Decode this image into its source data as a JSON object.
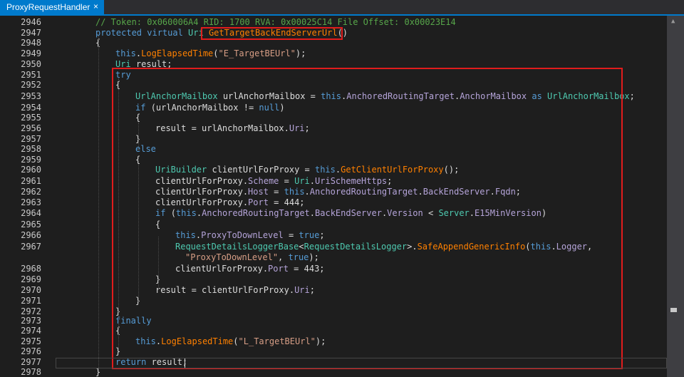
{
  "tab": {
    "title": "ProxyRequestHandler",
    "close_glyph": "×"
  },
  "colors": {
    "background": "#1e1e1e",
    "tab_active": "#007acc",
    "highlight_box": "#e01c1c",
    "comment": "#57a64a",
    "keyword": "#569cd6",
    "type": "#4ec9b0",
    "method": "#ff8000",
    "string": "#d69d85"
  },
  "lines": [
    {
      "n": "2946",
      "tokens": [
        [
          "c",
          "// Token: 0x060006A4 RID: 1700 RVA: 0x00025C14 File Offset: 0x00023E14"
        ]
      ]
    },
    {
      "n": "2947",
      "tokens": [
        [
          "k",
          "protected virtual "
        ],
        [
          "t",
          "Uri "
        ],
        [
          "m",
          "GetTargetBackEndServerUrl"
        ],
        [
          "p",
          "()"
        ]
      ]
    },
    {
      "n": "2948",
      "tokens": [
        [
          "p",
          "{"
        ]
      ]
    },
    {
      "n": "2949",
      "tokens": [
        [
          "k",
          "this"
        ],
        [
          "p",
          "."
        ],
        [
          "m",
          "LogElapsedTime"
        ],
        [
          "p",
          "("
        ],
        [
          "s",
          "\"E_TargetBEUrl\""
        ],
        [
          "p",
          ");"
        ]
      ]
    },
    {
      "n": "2950",
      "tokens": [
        [
          "t",
          "Uri "
        ],
        [
          "p",
          "result;"
        ]
      ]
    },
    {
      "n": "2951",
      "tokens": [
        [
          "k",
          "try"
        ]
      ]
    },
    {
      "n": "2952",
      "tokens": [
        [
          "p",
          "{"
        ]
      ]
    },
    {
      "n": "2953",
      "tokens": [
        [
          "t",
          "UrlAnchorMailbox "
        ],
        [
          "p",
          "urlAnchorMailbox = "
        ],
        [
          "k",
          "this"
        ],
        [
          "p",
          "."
        ],
        [
          "r",
          "AnchoredRoutingTarget"
        ],
        [
          "p",
          "."
        ],
        [
          "r",
          "AnchorMailbox "
        ],
        [
          "k",
          "as "
        ],
        [
          "t",
          "UrlAnchorMailbox"
        ],
        [
          "p",
          ";"
        ]
      ]
    },
    {
      "n": "2954",
      "tokens": [
        [
          "k",
          "if "
        ],
        [
          "p",
          "(urlAnchorMailbox != "
        ],
        [
          "k",
          "null"
        ],
        [
          "p",
          ")"
        ]
      ]
    },
    {
      "n": "2955",
      "tokens": [
        [
          "p",
          "{"
        ]
      ]
    },
    {
      "n": "2956",
      "tokens": [
        [
          "p",
          "result = urlAnchorMailbox."
        ],
        [
          "r",
          "Uri"
        ],
        [
          "p",
          ";"
        ]
      ]
    },
    {
      "n": "2957",
      "tokens": [
        [
          "p",
          "}"
        ]
      ]
    },
    {
      "n": "2958",
      "tokens": [
        [
          "k",
          "else"
        ]
      ]
    },
    {
      "n": "2959",
      "tokens": [
        [
          "p",
          "{"
        ]
      ]
    },
    {
      "n": "2960",
      "tokens": [
        [
          "t",
          "UriBuilder "
        ],
        [
          "p",
          "clientUrlForProxy = "
        ],
        [
          "k",
          "this"
        ],
        [
          "p",
          "."
        ],
        [
          "m",
          "GetClientUrlForProxy"
        ],
        [
          "p",
          "();"
        ]
      ]
    },
    {
      "n": "2961",
      "tokens": [
        [
          "p",
          "clientUrlForProxy."
        ],
        [
          "r",
          "Scheme"
        ],
        [
          "p",
          " = "
        ],
        [
          "t",
          "Uri"
        ],
        [
          "p",
          "."
        ],
        [
          "r",
          "UriSchemeHttps"
        ],
        [
          "p",
          ";"
        ]
      ]
    },
    {
      "n": "2962",
      "tokens": [
        [
          "p",
          "clientUrlForProxy."
        ],
        [
          "r",
          "Host"
        ],
        [
          "p",
          " = "
        ],
        [
          "k",
          "this"
        ],
        [
          "p",
          "."
        ],
        [
          "r",
          "AnchoredRoutingTarget"
        ],
        [
          "p",
          "."
        ],
        [
          "r",
          "BackEndServer"
        ],
        [
          "p",
          "."
        ],
        [
          "r",
          "Fqdn"
        ],
        [
          "p",
          ";"
        ]
      ]
    },
    {
      "n": "2963",
      "tokens": [
        [
          "p",
          "clientUrlForProxy."
        ],
        [
          "r",
          "Port"
        ],
        [
          "p",
          " = 444;"
        ]
      ]
    },
    {
      "n": "2964",
      "tokens": [
        [
          "k",
          "if "
        ],
        [
          "p",
          "("
        ],
        [
          "k",
          "this"
        ],
        [
          "p",
          "."
        ],
        [
          "r",
          "AnchoredRoutingTarget"
        ],
        [
          "p",
          "."
        ],
        [
          "r",
          "BackEndServer"
        ],
        [
          "p",
          "."
        ],
        [
          "r",
          "Version"
        ],
        [
          "p",
          " < "
        ],
        [
          "t",
          "Server"
        ],
        [
          "p",
          "."
        ],
        [
          "r",
          "E15MinVersion"
        ],
        [
          "p",
          ")"
        ]
      ]
    },
    {
      "n": "2965",
      "tokens": [
        [
          "p",
          "{"
        ]
      ]
    },
    {
      "n": "2966",
      "tokens": [
        [
          "k",
          "this"
        ],
        [
          "p",
          "."
        ],
        [
          "r",
          "ProxyToDownLevel"
        ],
        [
          "p",
          " = "
        ],
        [
          "k",
          "true"
        ],
        [
          "p",
          ";"
        ]
      ]
    },
    {
      "n": "2967",
      "tokens": [
        [
          "t",
          "RequestDetailsLoggerBase"
        ],
        [
          "p",
          "<"
        ],
        [
          "t",
          "RequestDetailsLogger"
        ],
        [
          "p",
          ">."
        ],
        [
          "m",
          "SafeAppendGenericInfo"
        ],
        [
          "p",
          "("
        ],
        [
          "k",
          "this"
        ],
        [
          "p",
          "."
        ],
        [
          "r",
          "Logger"
        ],
        [
          "p",
          ","
        ]
      ]
    },
    {
      "n": "",
      "tokens": [
        [
          "s",
          "\"ProxyToDownLevel\""
        ],
        [
          "p",
          ", "
        ],
        [
          "k",
          "true"
        ],
        [
          "p",
          ");"
        ]
      ]
    },
    {
      "n": "2968",
      "tokens": [
        [
          "p",
          "clientUrlForProxy."
        ],
        [
          "r",
          "Port"
        ],
        [
          "p",
          " = 443;"
        ]
      ]
    },
    {
      "n": "2969",
      "tokens": [
        [
          "p",
          "}"
        ]
      ]
    },
    {
      "n": "2970",
      "tokens": [
        [
          "p",
          "result = clientUrlForProxy."
        ],
        [
          "r",
          "Uri"
        ],
        [
          "p",
          ";"
        ]
      ]
    },
    {
      "n": "2971",
      "tokens": [
        [
          "p",
          "}"
        ]
      ]
    },
    {
      "n": "2972",
      "tokens": [
        [
          "p",
          "}"
        ]
      ]
    },
    {
      "n": "2973",
      "tokens": [
        [
          "k",
          "finally"
        ]
      ]
    },
    {
      "n": "2974",
      "tokens": [
        [
          "p",
          "{"
        ]
      ]
    },
    {
      "n": "2975",
      "tokens": [
        [
          "k",
          "this"
        ],
        [
          "p",
          "."
        ],
        [
          "m",
          "LogElapsedTime"
        ],
        [
          "p",
          "("
        ],
        [
          "s",
          "\"L_TargetBEUrl\""
        ],
        [
          "p",
          ");"
        ]
      ]
    },
    {
      "n": "2976",
      "tokens": [
        [
          "p",
          "}"
        ]
      ]
    },
    {
      "n": "2977",
      "tokens": [
        [
          "k",
          "return "
        ],
        [
          "p",
          "result;"
        ]
      ]
    },
    {
      "n": "2978",
      "tokens": [
        [
          "p",
          "}"
        ]
      ]
    }
  ]
}
